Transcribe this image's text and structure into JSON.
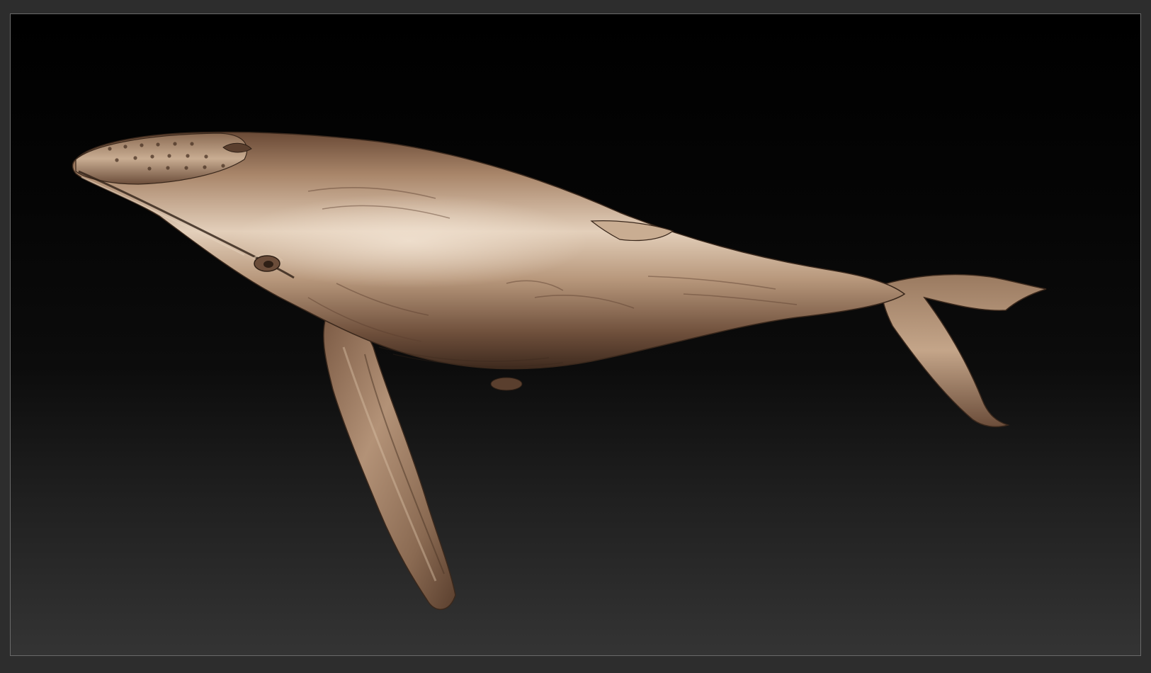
{
  "scene": {
    "subject": "whale-sculpt",
    "colors": {
      "frame": "#2d2d2d",
      "viewport_border": "#6a6a6a",
      "background_top": "#000000",
      "background_bottom": "#343434",
      "material_light": "#e3cfba",
      "material_mid": "#a9866a",
      "material_dark": "#4a3324"
    }
  }
}
